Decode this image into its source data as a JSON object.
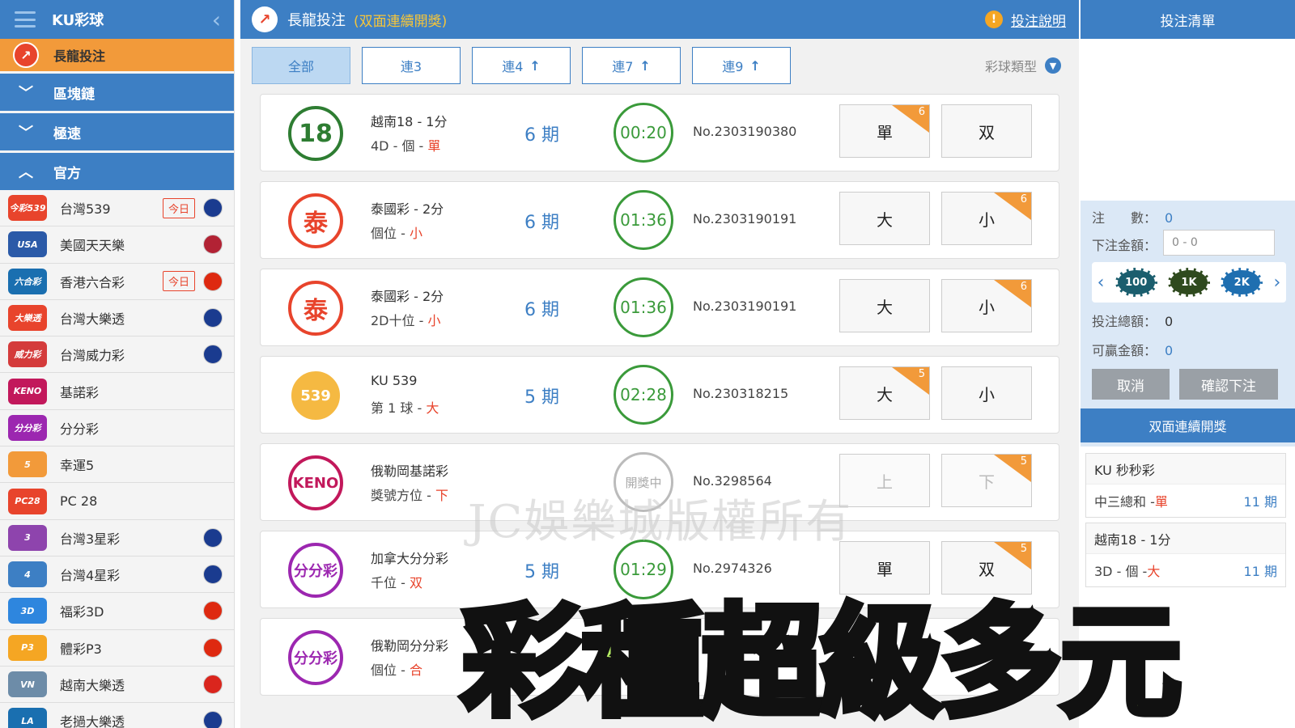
{
  "sidebar": {
    "brand": "KU彩球",
    "active_item": "長龍投注",
    "sections": [
      "區塊鏈",
      "極速",
      "官方"
    ],
    "items": [
      {
        "label": "台灣539",
        "today": "今日",
        "logo_text": "今彩539",
        "logo_color": "#e8442c",
        "flag_color": "#1a3b8f"
      },
      {
        "label": "美國天天樂",
        "today": "",
        "logo_text": "USA",
        "logo_color": "#2b5aa8",
        "flag_color": "#b22234"
      },
      {
        "label": "香港六合彩",
        "today": "今日",
        "logo_text": "六合彩",
        "logo_color": "#1a6fb0",
        "flag_color": "#de2910"
      },
      {
        "label": "台灣大樂透",
        "today": "",
        "logo_text": "大樂透",
        "logo_color": "#e8442c",
        "flag_color": "#1a3b8f"
      },
      {
        "label": "台灣威力彩",
        "today": "",
        "logo_text": "威力彩",
        "logo_color": "#d43b3b",
        "flag_color": "#1a3b8f"
      },
      {
        "label": "基諾彩",
        "today": "",
        "logo_text": "KENO",
        "logo_color": "#c2185b",
        "flag_color": ""
      },
      {
        "label": "分分彩",
        "today": "",
        "logo_text": "分分彩",
        "logo_color": "#9c27b0",
        "flag_color": ""
      },
      {
        "label": "幸運5",
        "today": "",
        "logo_text": "5",
        "logo_color": "#f29a3a",
        "flag_color": ""
      },
      {
        "label": "PC 28",
        "today": "",
        "logo_text": "PC28",
        "logo_color": "#e8442c",
        "flag_color": ""
      },
      {
        "label": "台灣3星彩",
        "today": "",
        "logo_text": "3",
        "logo_color": "#8e44ad",
        "flag_color": "#1a3b8f"
      },
      {
        "label": "台灣4星彩",
        "today": "",
        "logo_text": "4",
        "logo_color": "#3d7fc4",
        "flag_color": "#1a3b8f"
      },
      {
        "label": "福彩3D",
        "today": "",
        "logo_text": "3D",
        "logo_color": "#2e86de",
        "flag_color": "#de2910"
      },
      {
        "label": "體彩P3",
        "today": "",
        "logo_text": "P3",
        "logo_color": "#f5a623",
        "flag_color": "#de2910"
      },
      {
        "label": "越南大樂透",
        "today": "",
        "logo_text": "VN",
        "logo_color": "#6d8ca8",
        "flag_color": "#da251d"
      },
      {
        "label": "老撾大樂透",
        "today": "",
        "logo_text": "LA",
        "logo_color": "#1a6fb0",
        "flag_color": "#1a3b8f"
      }
    ]
  },
  "header": {
    "title": "長龍投注",
    "subtitle": "(双面連續開獎)",
    "help_link": "投注說明"
  },
  "tabs": [
    {
      "label": "全部",
      "arrow": ""
    },
    {
      "label": "連3",
      "arrow": ""
    },
    {
      "label": "連4",
      "arrow": "↑"
    },
    {
      "label": "連7",
      "arrow": "↑"
    },
    {
      "label": "連9",
      "arrow": "↑"
    }
  ],
  "filter_label": "彩球類型",
  "rows": [
    {
      "logo": "18",
      "logo_bg": "#ffffff",
      "logo_fg": "#2e7d32",
      "name": "越南18 - 1分",
      "sub": "4D - 個 - ",
      "sub_hl": "單",
      "periods": "6 期",
      "timer": "00:20",
      "timer_off": false,
      "issue": "No.2303190380",
      "btn1": "單",
      "btn2": "双",
      "badge_on": 1,
      "badge": "6",
      "disabled": false
    },
    {
      "logo": "泰",
      "logo_bg": "#ffffff",
      "logo_fg": "#e8442c",
      "name": "泰國彩 - 2分",
      "sub": "個位 - ",
      "sub_hl": "小",
      "periods": "6 期",
      "timer": "01:36",
      "timer_off": false,
      "issue": "No.2303190191",
      "btn1": "大",
      "btn2": "小",
      "badge_on": 2,
      "badge": "6",
      "disabled": false
    },
    {
      "logo": "泰",
      "logo_bg": "#ffffff",
      "logo_fg": "#e8442c",
      "name": "泰國彩 - 2分",
      "sub": "2D十位 - ",
      "sub_hl": "小",
      "periods": "6 期",
      "timer": "01:36",
      "timer_off": false,
      "issue": "No.2303190191",
      "btn1": "大",
      "btn2": "小",
      "badge_on": 2,
      "badge": "6",
      "disabled": false
    },
    {
      "logo": "539",
      "logo_bg": "#f5b942",
      "logo_fg": "#ffffff",
      "name": "KU 539",
      "sub": "第 1 球 - ",
      "sub_hl": "大",
      "periods": "5 期",
      "timer": "02:28",
      "timer_off": false,
      "issue": "No.230318215",
      "btn1": "大",
      "btn2": "小",
      "badge_on": 1,
      "badge": "5",
      "disabled": false
    },
    {
      "logo": "KENO",
      "logo_bg": "#ffffff",
      "logo_fg": "#c2185b",
      "name": "俄勒岡基諾彩",
      "sub": "獎號方位 - ",
      "sub_hl": "下",
      "periods": "",
      "timer": "開獎中",
      "timer_off": true,
      "issue": "No.3298564",
      "btn1": "上",
      "btn2": "下",
      "badge_on": 2,
      "badge": "5",
      "disabled": true
    },
    {
      "logo": "分分彩",
      "logo_bg": "#ffffff",
      "logo_fg": "#9c27b0",
      "name": "加拿大分分彩",
      "sub": "千位 - ",
      "sub_hl": "双",
      "periods": "5 期",
      "timer": "01:29",
      "timer_off": false,
      "issue": "No.2974326",
      "btn1": "單",
      "btn2": "双",
      "badge_on": 2,
      "badge": "5",
      "disabled": false
    },
    {
      "logo": "分分彩",
      "logo_bg": "#ffffff",
      "logo_fg": "#9c27b0",
      "name": "俄勒岡分分彩",
      "sub": "個位 - ",
      "sub_hl": "合",
      "periods": "",
      "timer": "",
      "timer_off": false,
      "issue": "",
      "btn1": "",
      "btn2": "",
      "badge_on": 0,
      "badge": "",
      "disabled": false
    }
  ],
  "betslip": {
    "title": "投注清單",
    "count_label": "注　　數：",
    "count_value": "0",
    "amount_label": "下注金額：",
    "amount_placeholder": "0 - 0",
    "chips": [
      "100",
      "1K",
      "2K"
    ],
    "total_label": "投注總額：",
    "total_value": "0",
    "win_label": "可贏金額：",
    "win_value": "0",
    "cancel": "取消",
    "confirm": "確認下注",
    "section_title": "双面連續開獎"
  },
  "cards": [
    {
      "title": "KU 秒秒彩",
      "body": "中三總和 - ",
      "hl": "單",
      "periods": "11 期"
    },
    {
      "title": "越南18 - 1分",
      "body": "3D - 個 - ",
      "hl": "大",
      "periods": "11 期"
    }
  ],
  "watermark": "JC娛樂城版權所有",
  "promo": "彩種超級多元",
  "colors": {
    "primary": "#3d7fc4",
    "accent": "#f29a3a",
    "red": "#e8442c",
    "green": "#3a9a3a"
  }
}
